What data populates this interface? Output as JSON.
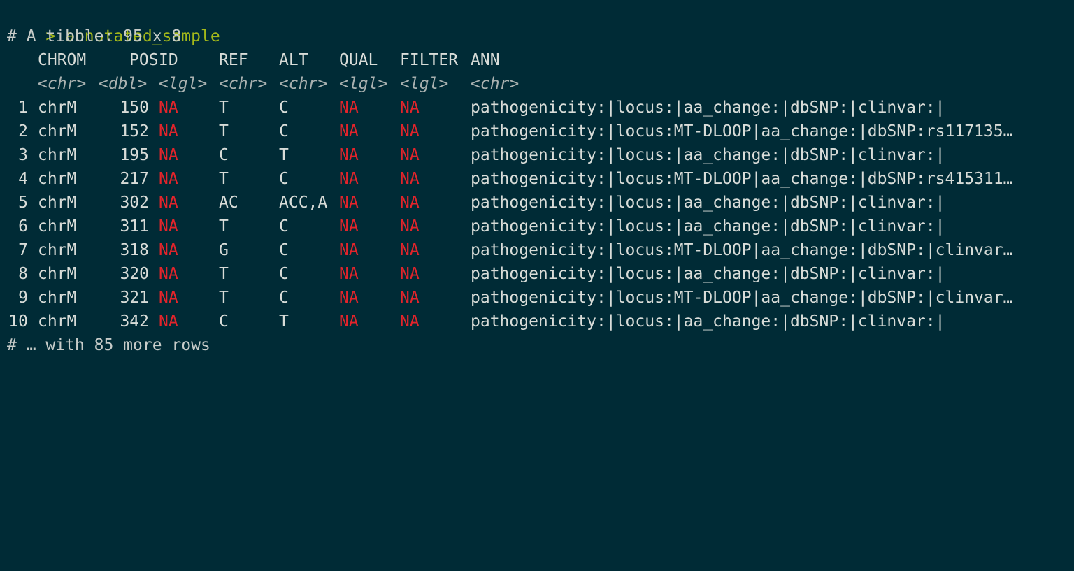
{
  "prompt": {
    "symbol": ">",
    "command": "annotated_sample"
  },
  "tibble_header": "# A tibble: 95 x 8",
  "columns": {
    "names": [
      "CHROM",
      "POS",
      "ID",
      "REF",
      "ALT",
      "QUAL",
      "FILTER",
      "ANN"
    ],
    "types": [
      "<chr>",
      "<dbl>",
      "<lgl>",
      "<chr>",
      "<chr>",
      "<lgl>",
      "<lgl>",
      "<chr>"
    ]
  },
  "rows": [
    {
      "n": "1",
      "chrom": "chrM",
      "pos": "150",
      "id": "NA",
      "ref": "T",
      "alt": "C",
      "qual": "NA",
      "filter": "NA",
      "ann": "pathogenicity:|locus:|aa_change:|dbSNP:|clinvar:|"
    },
    {
      "n": "2",
      "chrom": "chrM",
      "pos": "152",
      "id": "NA",
      "ref": "T",
      "alt": "C",
      "qual": "NA",
      "filter": "NA",
      "ann": "pathogenicity:|locus:MT-DLOOP|aa_change:|dbSNP:rs117135…"
    },
    {
      "n": "3",
      "chrom": "chrM",
      "pos": "195",
      "id": "NA",
      "ref": "C",
      "alt": "T",
      "qual": "NA",
      "filter": "NA",
      "ann": "pathogenicity:|locus:|aa_change:|dbSNP:|clinvar:|"
    },
    {
      "n": "4",
      "chrom": "chrM",
      "pos": "217",
      "id": "NA",
      "ref": "T",
      "alt": "C",
      "qual": "NA",
      "filter": "NA",
      "ann": "pathogenicity:|locus:MT-DLOOP|aa_change:|dbSNP:rs415311…"
    },
    {
      "n": "5",
      "chrom": "chrM",
      "pos": "302",
      "id": "NA",
      "ref": "AC",
      "alt": "ACC,A",
      "qual": "NA",
      "filter": "NA",
      "ann": "pathogenicity:|locus:|aa_change:|dbSNP:|clinvar:|"
    },
    {
      "n": "6",
      "chrom": "chrM",
      "pos": "311",
      "id": "NA",
      "ref": "T",
      "alt": "C",
      "qual": "NA",
      "filter": "NA",
      "ann": "pathogenicity:|locus:|aa_change:|dbSNP:|clinvar:|"
    },
    {
      "n": "7",
      "chrom": "chrM",
      "pos": "318",
      "id": "NA",
      "ref": "G",
      "alt": "C",
      "qual": "NA",
      "filter": "NA",
      "ann": "pathogenicity:|locus:MT-DLOOP|aa_change:|dbSNP:|clinvar…"
    },
    {
      "n": "8",
      "chrom": "chrM",
      "pos": "320",
      "id": "NA",
      "ref": "T",
      "alt": "C",
      "qual": "NA",
      "filter": "NA",
      "ann": "pathogenicity:|locus:|aa_change:|dbSNP:|clinvar:|"
    },
    {
      "n": "9",
      "chrom": "chrM",
      "pos": "321",
      "id": "NA",
      "ref": "T",
      "alt": "C",
      "qual": "NA",
      "filter": "NA",
      "ann": "pathogenicity:|locus:MT-DLOOP|aa_change:|dbSNP:|clinvar…"
    },
    {
      "n": "10",
      "chrom": "chrM",
      "pos": "342",
      "id": "NA",
      "ref": "C",
      "alt": "T",
      "qual": "NA",
      "filter": "NA",
      "ann": "pathogenicity:|locus:|aa_change:|dbSNP:|clinvar:|"
    }
  ],
  "footer": "# … with 85 more rows",
  "colors": {
    "background": "#002b36",
    "prompt": "#a3b81a",
    "na": "#e3242b",
    "text": "#d8dcd8"
  }
}
